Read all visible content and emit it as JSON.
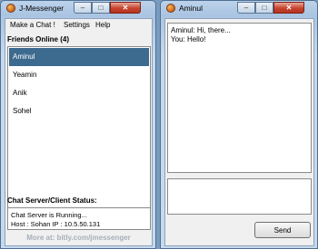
{
  "left_window": {
    "title": "J-Messenger",
    "controls": {
      "minimize": "–",
      "maximize": "□",
      "close": "✕"
    },
    "menu": [
      "Make a Chat !",
      "Settings",
      "Help"
    ],
    "friends_header": "Friends Online (4)",
    "friends": [
      "Aminul",
      "Yeamin",
      "Anik",
      "Sohel"
    ],
    "selected_friend": "Aminul",
    "status_header": "Chat Server/Client Status:",
    "status_lines": [
      "Chat Server is Running...",
      "Host : Sohan    IP : 10.5.50.131"
    ],
    "footer": "More at: bitly.com/jmessenger"
  },
  "right_window": {
    "title": "Aminul",
    "controls": {
      "minimize": "–",
      "maximize": "□",
      "close": "✕"
    },
    "messages": [
      "Aminul: Hi, there...",
      "You: Hello!"
    ],
    "input_value": "",
    "send_label": "Send"
  },
  "colors": {
    "selection": "#3d6a8f",
    "desktop": "#7a9cbf",
    "close_button": "#c7432e"
  },
  "icons": {
    "app_icon": "orange-circle-app-icon"
  }
}
